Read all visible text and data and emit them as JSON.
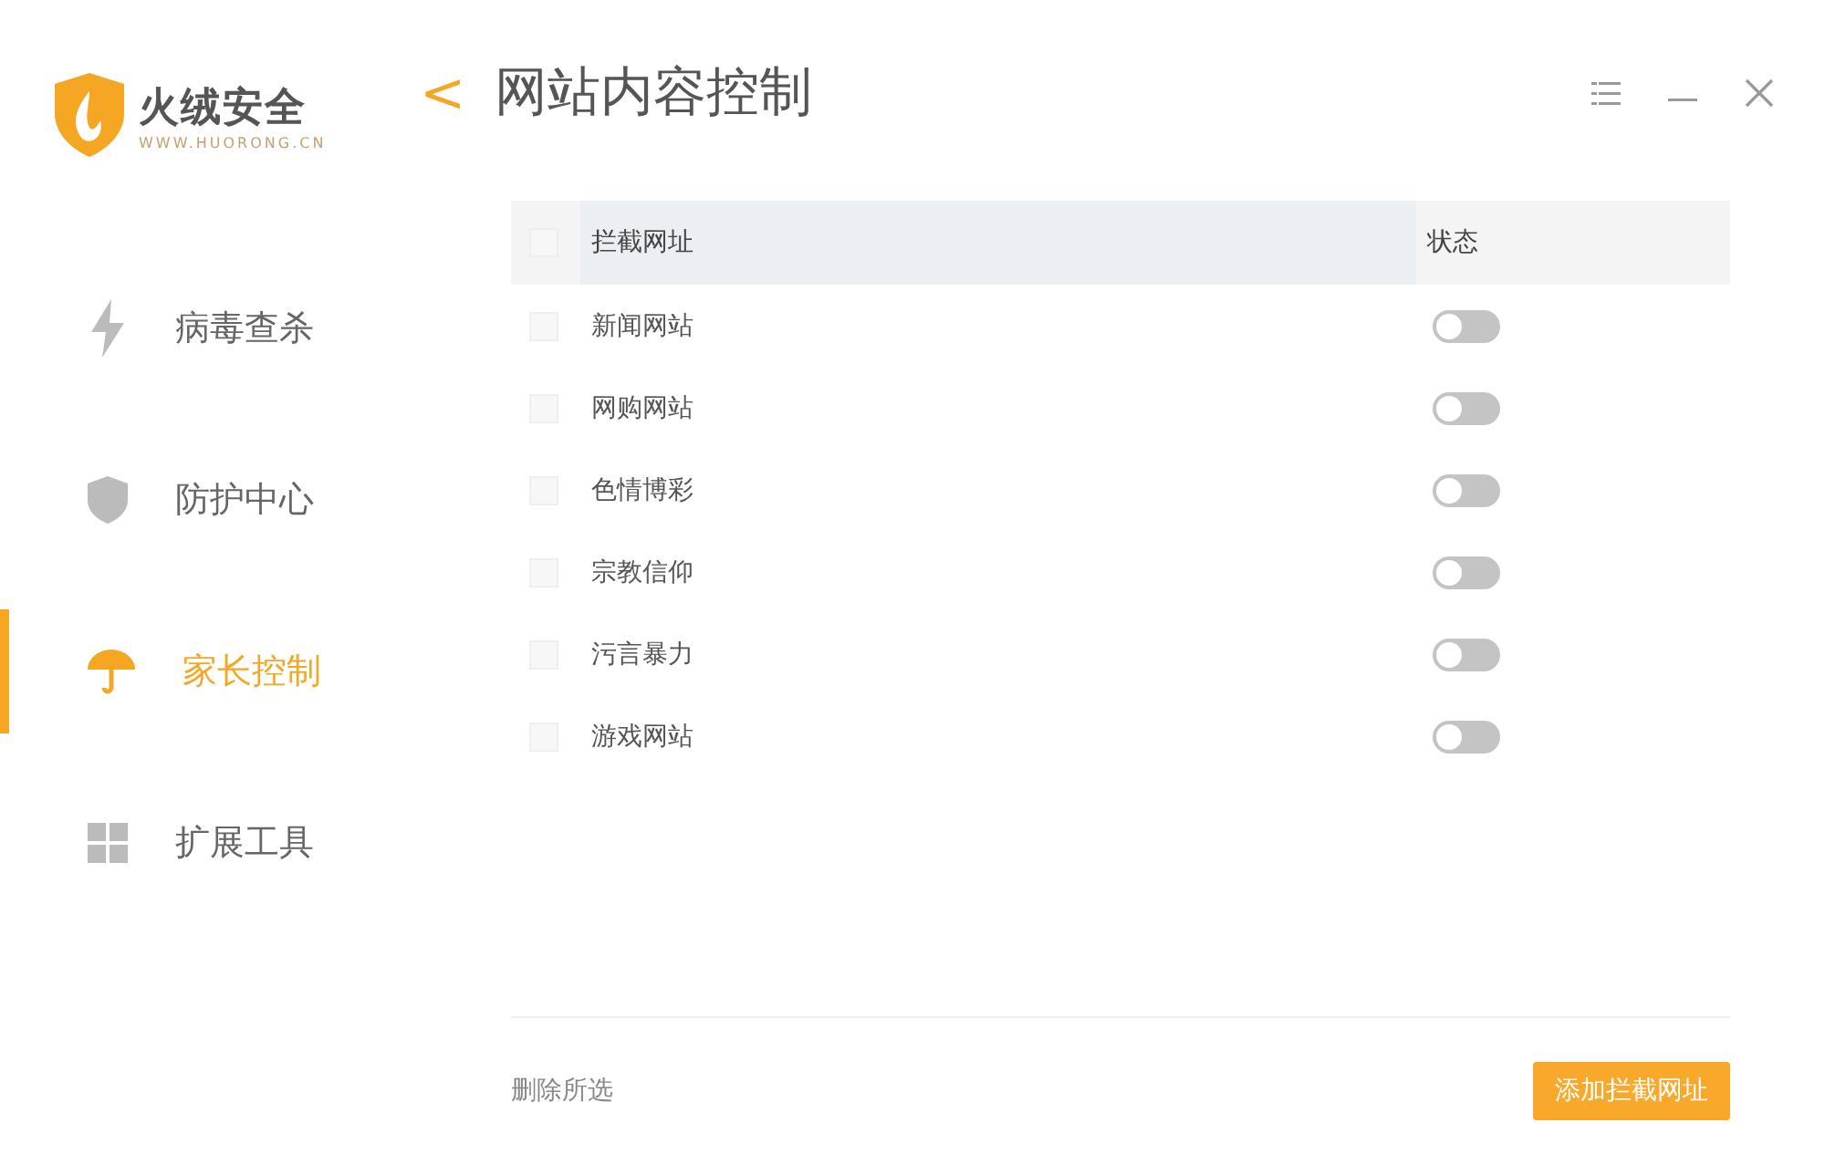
{
  "brand": {
    "name": "火绒安全",
    "url": "WWW.HUORONG.CN"
  },
  "page": {
    "back": "<",
    "title": "网站内容控制"
  },
  "sidebar": {
    "items": [
      {
        "label": "病毒查杀",
        "selected": false
      },
      {
        "label": "防护中心",
        "selected": false
      },
      {
        "label": "家长控制",
        "selected": true
      },
      {
        "label": "扩展工具",
        "selected": false
      }
    ]
  },
  "table": {
    "columns": [
      "拦截网址",
      "状态"
    ],
    "all_checked": false,
    "rows": [
      {
        "name": "新闻网站",
        "checked": false,
        "on": false
      },
      {
        "name": "网购网站",
        "checked": false,
        "on": false
      },
      {
        "name": "色情博彩",
        "checked": false,
        "on": false
      },
      {
        "name": "宗教信仰",
        "checked": false,
        "on": false
      },
      {
        "name": "污言暴力",
        "checked": false,
        "on": false
      },
      {
        "name": "游戏网站",
        "checked": false,
        "on": false
      }
    ]
  },
  "footer": {
    "delete": "删除所选",
    "add": "添加拦截网址"
  }
}
